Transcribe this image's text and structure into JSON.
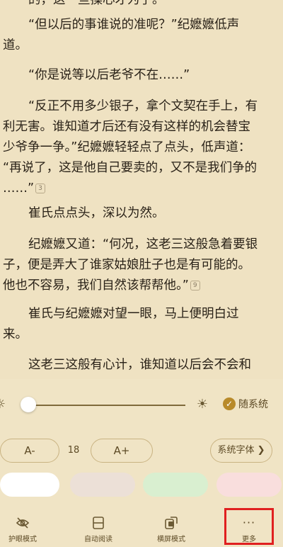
{
  "reader": {
    "paragraphs": [
      {
        "lines": [
          "的，这一些操心才为了。",
          "“但以后的事谁说的准呢？”纪嬷嬷低声",
          "道。"
        ]
      },
      {
        "lines": [
          "“你是说等以后老爷不在……”"
        ]
      },
      {
        "lines": [
          "“反正不用多少银子，拿个文契在手上，有",
          "利无害。谁知道才后还有没有这样的机会替宝",
          "少爷争一争。”纪嬷嬷轻轻点了点头，低声道：",
          "“再说了，这是他自己要卖的，又不是我们争的",
          "……”"
        ],
        "comment_count": "3"
      },
      {
        "lines": [
          "崔氏点点头，深以为然。"
        ]
      },
      {
        "lines": [
          "纪嬷嬷又道：“何况，这老三这般急着要银",
          "子，便是弄大了谁家姑娘肚子也是有可能的。",
          "他也不容易，我们自然该帮帮他。”"
        ],
        "comment_count": "9"
      },
      {
        "lines": [
          "崔氏与纪嬷嬷对望一眼，马上便明白过",
          "来。"
        ]
      },
      {
        "lines": [
          "这老三这般有心计，谁知道以后会不会和"
        ]
      }
    ]
  },
  "brightness": {
    "level": 0.0,
    "follow_system_label": "随系统"
  },
  "font": {
    "decrease_label": "A-",
    "size": "18",
    "increase_label": "A+",
    "system_font_label": "系统字体"
  },
  "themes": {
    "colors": [
      "#ffffff",
      "#ece0d7",
      "#d9efd0",
      "#f9dedd"
    ]
  },
  "toolbar": {
    "eye_mode": "护眼模式",
    "auto_read": "自动阅读",
    "landscape": "横屏模式",
    "more_icon": "···",
    "more": "更多"
  },
  "colors": {
    "highlight": "#e02020",
    "accent": "#b88a2a"
  }
}
